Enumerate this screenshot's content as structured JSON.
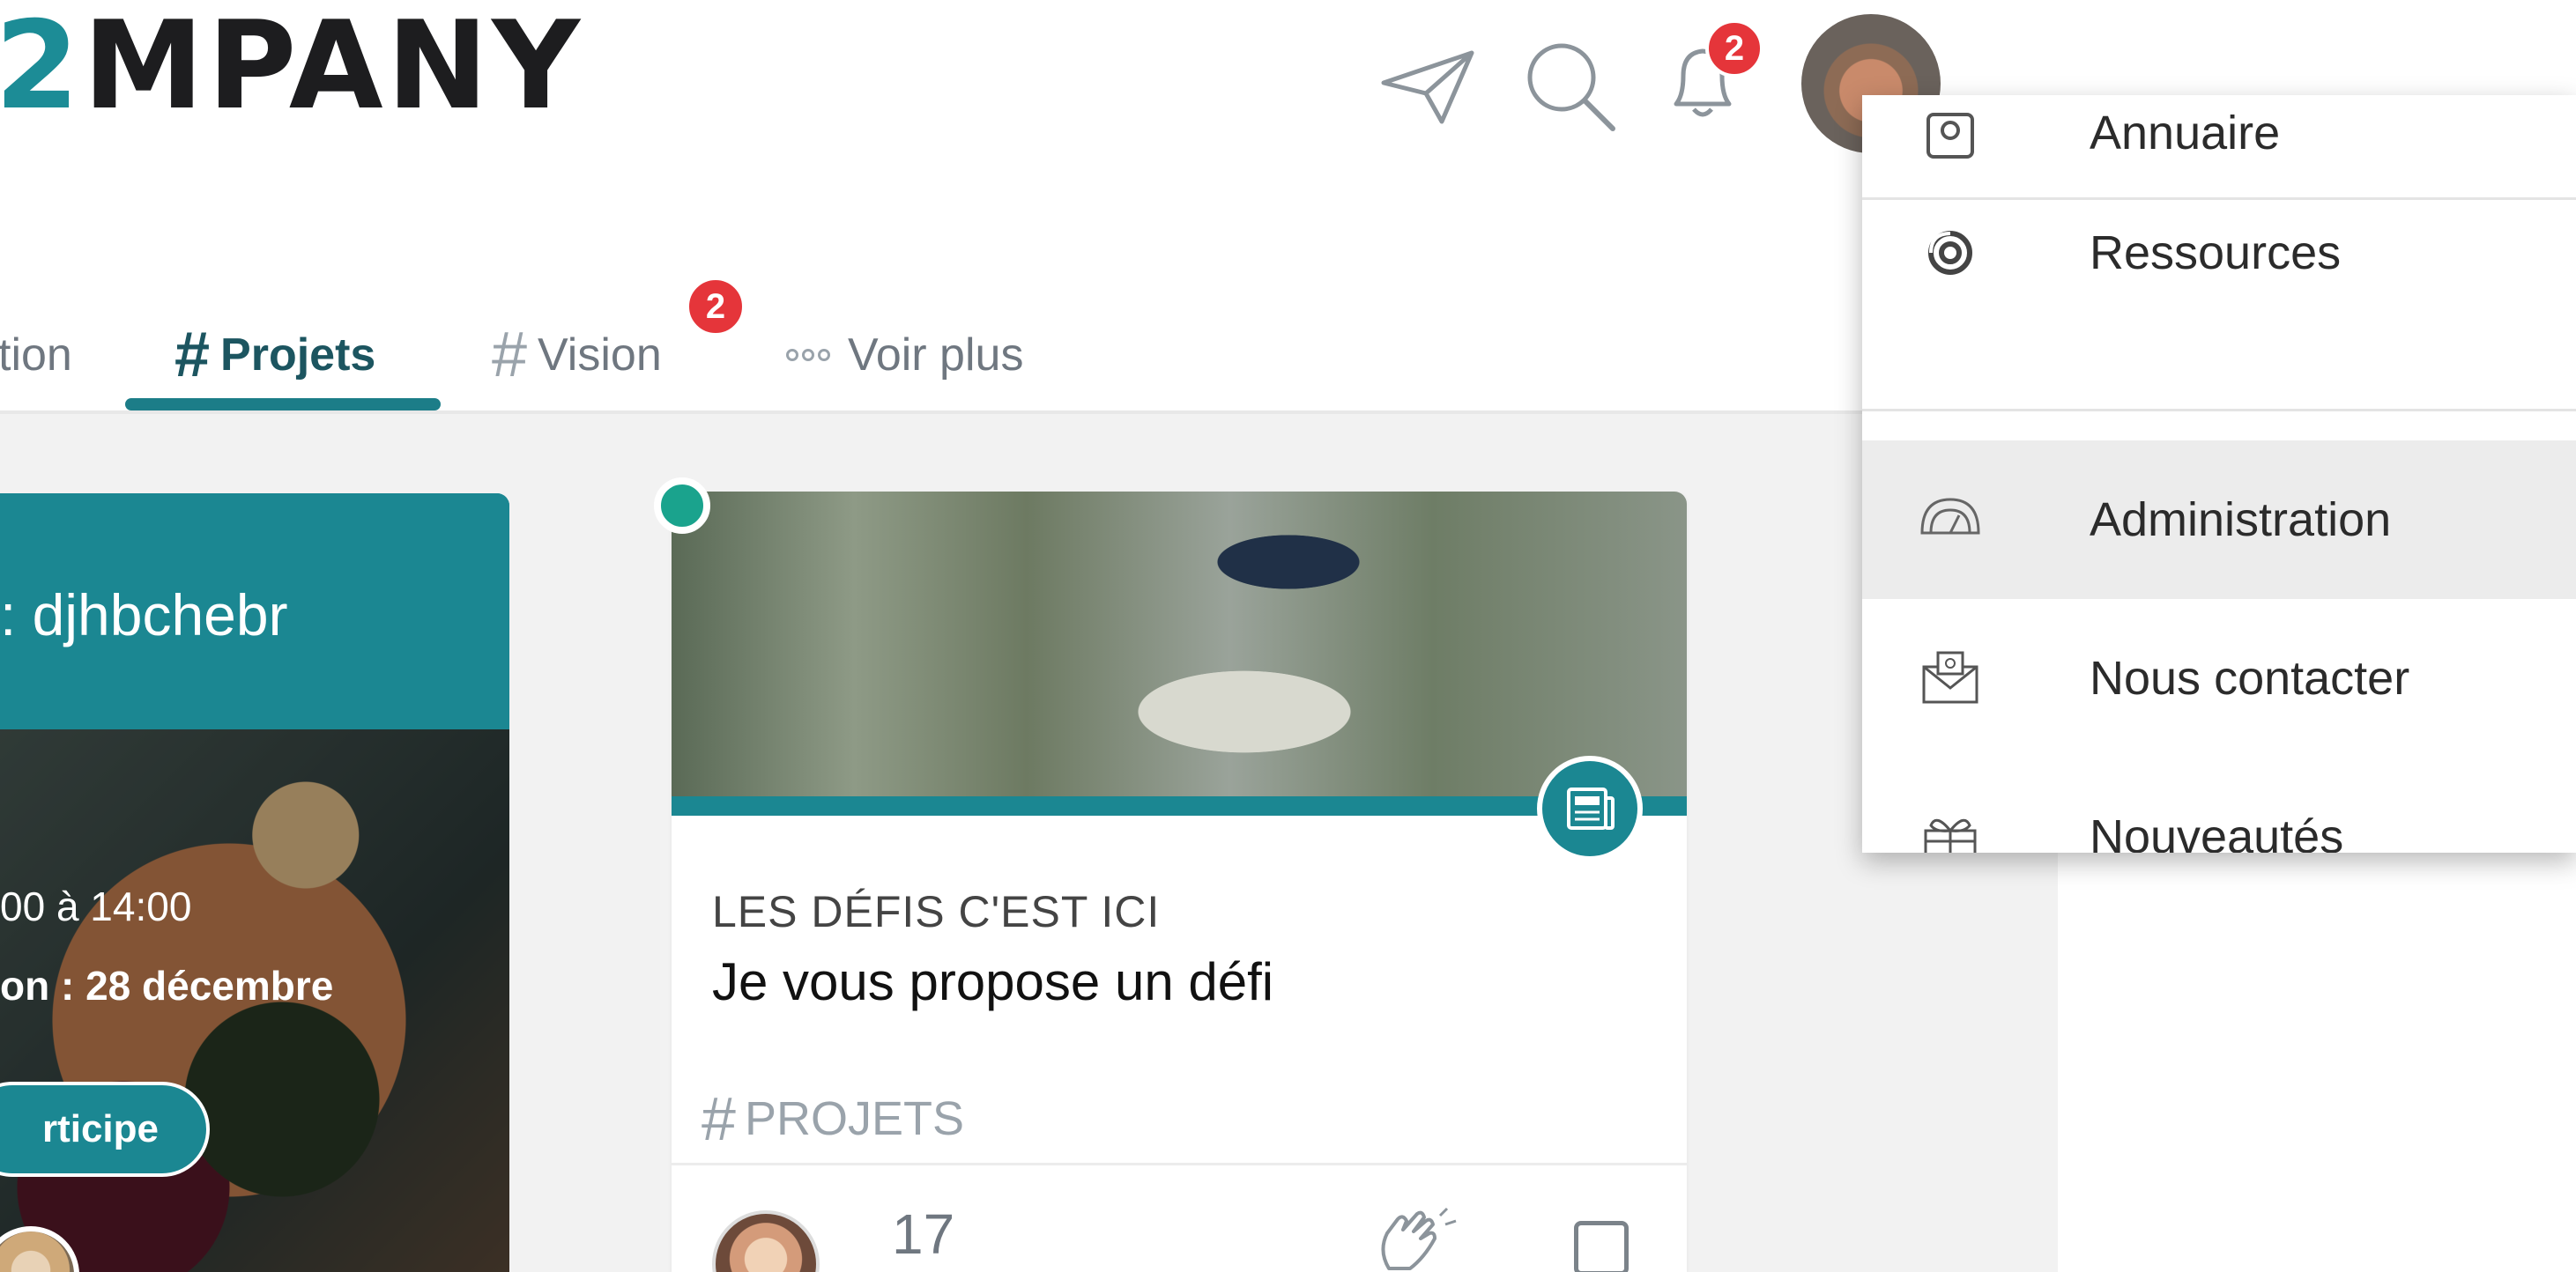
{
  "app": {
    "logo_accent": "2",
    "logo_text": "MPANY",
    "accent_color": "#1b8792",
    "badge_color": "#e5353a"
  },
  "header": {
    "icons": [
      "paper-plane-icon",
      "search-icon",
      "bell-icon"
    ],
    "notifications_count": "2"
  },
  "tabs": [
    {
      "label": "tion",
      "hash": ""
    },
    {
      "label": "Projets",
      "hash": "#"
    },
    {
      "label": "Vision",
      "hash": "#",
      "badge": "2"
    },
    {
      "label": "Voir plus",
      "hash": ""
    }
  ],
  "event_card": {
    "title": ": djhbchebr",
    "time": "00 à 14:00",
    "deadline": "on : 28 décembre",
    "button": "rticipe"
  },
  "post_card": {
    "category": "LES DÉFIS C'EST ICI",
    "title": "Je vous propose un défi",
    "tag_hash": "#",
    "tag": "PROJETS",
    "count": "17"
  },
  "dropdown": {
    "items": [
      {
        "label": "Annuaire",
        "icon": "directory-icon"
      },
      {
        "label": "Ressources",
        "icon": "resources-icon"
      },
      {
        "label": "Administration",
        "icon": "dashboard-gauge-icon",
        "active": true
      },
      {
        "label": "Nous contacter",
        "icon": "envelope-icon"
      },
      {
        "label": "Nouveautés",
        "icon": "gift-icon"
      }
    ]
  }
}
